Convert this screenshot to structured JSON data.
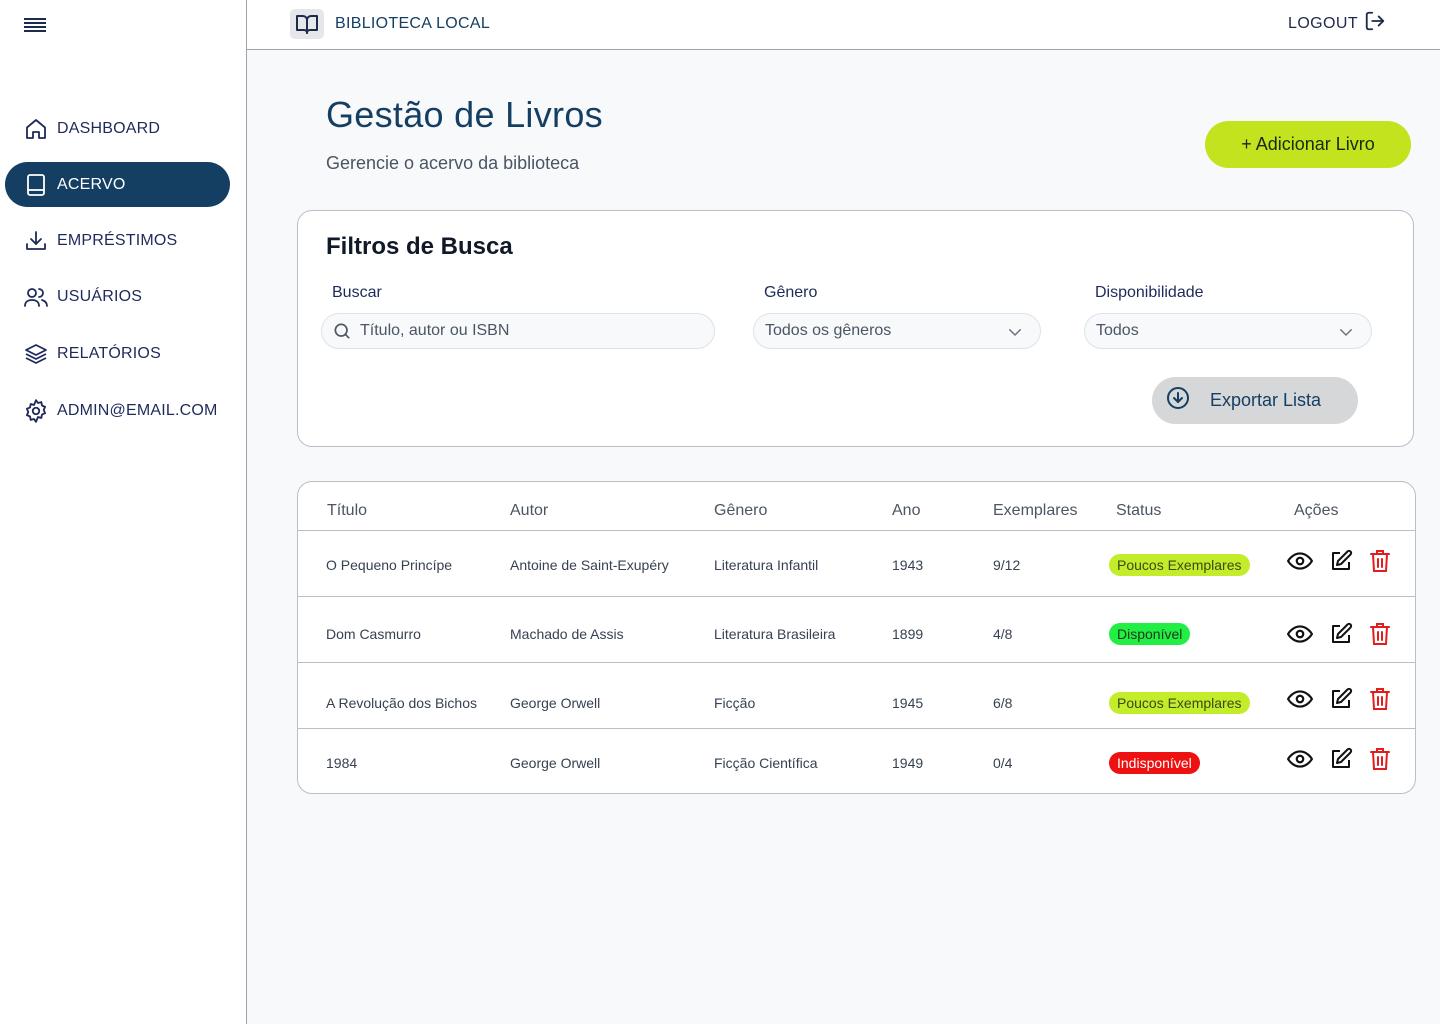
{
  "topbar": {
    "brand": "BIBLIOTECA LOCAL",
    "logout": "LOGOUT"
  },
  "sidebar": {
    "items": [
      {
        "label": "DASHBOARD",
        "icon": "home-icon"
      },
      {
        "label": "ACERVO",
        "icon": "book-icon",
        "active": true
      },
      {
        "label": "EMPRÉSTIMOS",
        "icon": "download-icon"
      },
      {
        "label": "USUÁRIOS",
        "icon": "users-icon"
      },
      {
        "label": "RELATÓRIOS",
        "icon": "layers-icon"
      },
      {
        "label": "ADMIN@EMAIL.COM",
        "icon": "gear-icon"
      }
    ]
  },
  "header": {
    "title": "Gestão de Livros",
    "subtitle": "Gerencie o acervo da biblioteca",
    "add_button": "+ Adicionar Livro"
  },
  "filters": {
    "title": "Filtros de Busca",
    "search": {
      "label": "Buscar",
      "placeholder": "Título, autor ou ISBN"
    },
    "genre": {
      "label": "Gênero",
      "value": "Todos os gêneros"
    },
    "availability": {
      "label": "Disponibilidade",
      "value": "Todos"
    },
    "export_button": "Exportar Lista"
  },
  "table": {
    "headers": [
      "Título",
      "Autor",
      "Gênero",
      "Ano",
      "Exemplares",
      "Status",
      "Ações"
    ],
    "rows": [
      {
        "title": "O Pequeno Princípe",
        "author": "Antoine de Saint-Exupéry",
        "genre": "Literatura Infantil",
        "year": "1943",
        "copies": "9/12",
        "status": "Poucos Exemplares",
        "status_type": "few"
      },
      {
        "title": "Dom Casmurro",
        "author": "Machado de Assis",
        "genre": "Literatura Brasileira",
        "year": "1899",
        "copies": "4/8",
        "status": "Disponível",
        "status_type": "ok"
      },
      {
        "title": "A Revolução dos Bichos",
        "author": "George Orwell",
        "genre": "Ficção",
        "year": "1945",
        "copies": "6/8",
        "status": "Poucos Exemplares",
        "status_type": "few"
      },
      {
        "title": "1984",
        "author": "George Orwell",
        "genre": "Ficção Científica",
        "year": "1949",
        "copies": "0/4",
        "status": "Indisponível",
        "status_type": "no"
      }
    ]
  },
  "colors": {
    "primary": "#153e63",
    "accent": "#c3e31e",
    "status_few": "#c3ec2a",
    "status_ok": "#22ee44",
    "status_no": "#ee1111",
    "delete": "#e11d1d"
  }
}
